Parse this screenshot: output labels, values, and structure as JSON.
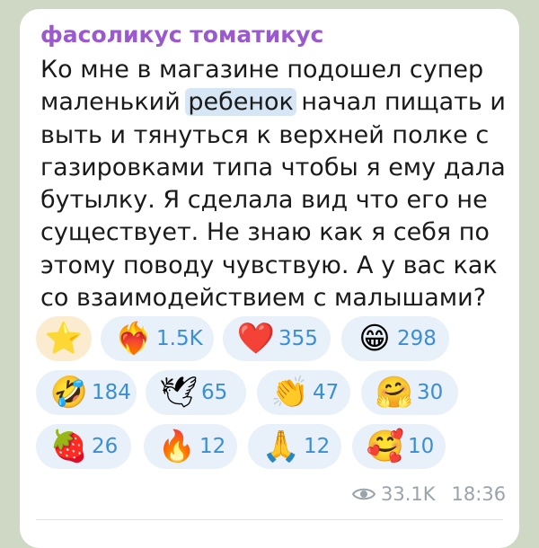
{
  "message": {
    "sender": "фасоликус томатикус",
    "lines": [
      {
        "before": "Ко мне в магазине подошел супер",
        "highlight": "",
        "after": ""
      },
      {
        "before": "маленький ",
        "highlight": "ребенок",
        "after": " начал пищать и"
      },
      {
        "before": "выть и тянуться к верхней полке с",
        "highlight": "",
        "after": ""
      },
      {
        "before": "газировками типа чтобы я ему дала",
        "highlight": "",
        "after": ""
      },
      {
        "before": "бутылку. Я сделала вид что его не",
        "highlight": "",
        "after": ""
      },
      {
        "before": "существует. Не знаю как я себя по",
        "highlight": "",
        "after": ""
      },
      {
        "before": "этому поводу чувствую. А у вас как",
        "highlight": "",
        "after": ""
      },
      {
        "before": "со взаимодействием с малышами?",
        "highlight": "",
        "after": ""
      }
    ],
    "views": "33.1K",
    "time": "18:36"
  },
  "reactions": [
    {
      "emoji": "⭐",
      "icon": "star-icon",
      "count": ""
    },
    {
      "emoji": "❤️‍🔥",
      "icon": "heart-on-fire-icon",
      "count": "1.5K"
    },
    {
      "emoji": "❤️",
      "icon": "red-heart-icon",
      "count": "355"
    },
    {
      "emoji": "😁",
      "icon": "grinning-face-icon",
      "count": "298"
    },
    {
      "emoji": "🤣",
      "icon": "rolling-laughing-icon",
      "count": "184"
    },
    {
      "emoji": "🕊",
      "icon": "dove-icon",
      "count": "65"
    },
    {
      "emoji": "👏",
      "icon": "clapping-hands-icon",
      "count": "47"
    },
    {
      "emoji": "🤗",
      "icon": "hugging-face-icon",
      "count": "30"
    },
    {
      "emoji": "🍓",
      "icon": "strawberry-icon",
      "count": "26"
    },
    {
      "emoji": "🔥",
      "icon": "fire-icon",
      "count": "12"
    },
    {
      "emoji": "🙏",
      "icon": "folded-hands-icon",
      "count": "12"
    },
    {
      "emoji": "🥰",
      "icon": "smiling-face-hearts-icon",
      "count": "10"
    }
  ],
  "colors": {
    "sender": "#9b59d0",
    "reaction_count": "#3b8ed3",
    "chip_bg": "#e8f0f9",
    "chip_selected_bg": "#fbeccf",
    "highlight": "#d6e6f5"
  }
}
